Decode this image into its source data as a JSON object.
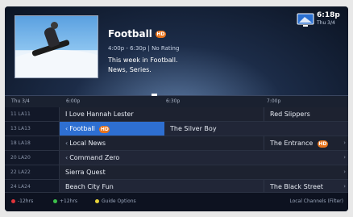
{
  "info": {
    "title": "Football",
    "badge": "HD",
    "meta": "4:00p - 6:30p  |  No Rating",
    "desc_line1": "This week in Football.",
    "desc_line2": "News, Series."
  },
  "clock": {
    "time": "6:18p",
    "date": "Thu 3/4"
  },
  "timeline": {
    "date": "Thu 3/4",
    "t1": "6:00p",
    "t2": "6:30p",
    "t3": "7:00p"
  },
  "rows": [
    {
      "chan": "11  LA11",
      "a": "I Love Hannah Lester",
      "b": "Red Slippers"
    },
    {
      "chan": "13  LA13",
      "a": "Football",
      "a_badge": "HD",
      "b": "The Silver Boy"
    },
    {
      "chan": "18  LA18",
      "a": "Local News",
      "b": "The Entrance",
      "b_badge": "HD"
    },
    {
      "chan": "20  LA20",
      "a": "Command Zero"
    },
    {
      "chan": "22  LA22",
      "a": "Sierra Quest"
    },
    {
      "chan": "24  LA24",
      "a": "Beach City Fun",
      "b": "The Black Street"
    }
  ],
  "footer": {
    "red": "-12hrs",
    "green": "+12hrs",
    "yellow": "Guide Options",
    "right": "Local Channels (Filter)"
  },
  "colors": {
    "selected": "#2e6fd1",
    "badge": "#e8731a",
    "red": "#e0343a",
    "green": "#3cc04a",
    "yellow": "#e6d23a"
  }
}
